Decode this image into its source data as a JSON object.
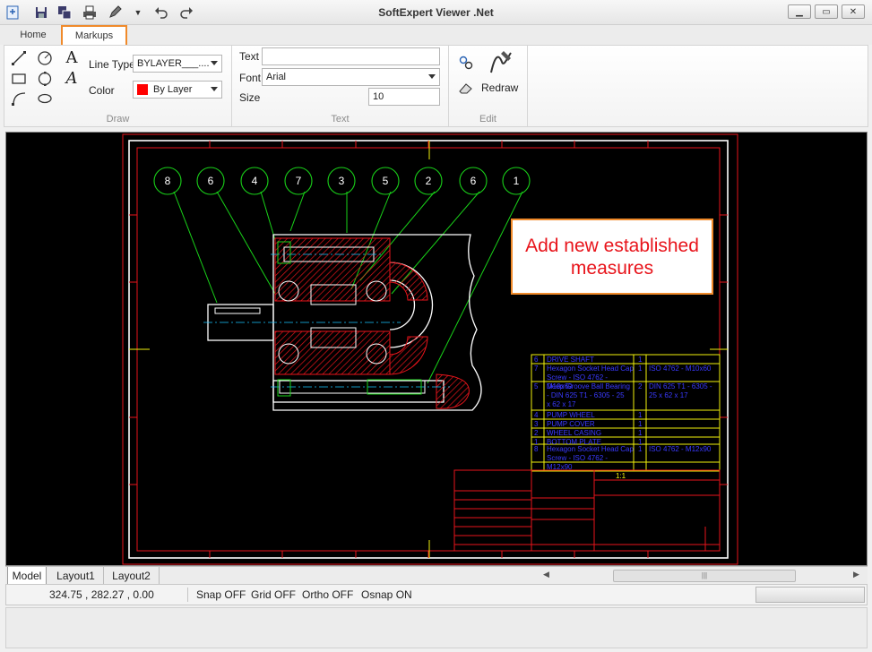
{
  "window": {
    "title": "SoftExpert Viewer .Net"
  },
  "quick_access": [
    "app-icon",
    "save-icon",
    "save-all-icon",
    "print-icon",
    "pen-icon",
    "dropdown-arrow-icon",
    "undo-icon",
    "redo-icon"
  ],
  "tabs": [
    {
      "label": "Home"
    },
    {
      "label": "Markups",
      "selected": true
    }
  ],
  "ribbon": {
    "draw": {
      "caption": "Draw",
      "line_type_label": "Line Type",
      "line_type_value": "BYLAYER___....",
      "color_label": "Color",
      "color_value": "By Layer",
      "color_swatch": "#ff0000"
    },
    "text": {
      "caption": "Text",
      "text_label": "Text",
      "text_value": "",
      "font_label": "Font",
      "font_value": "Arial",
      "size_label": "Size",
      "size_value": "10"
    },
    "edit": {
      "caption": "Edit",
      "redraw_label": "Redraw"
    }
  },
  "drawing": {
    "balloons": [
      "8",
      "6",
      "4",
      "7",
      "3",
      "5",
      "2",
      "6",
      "1"
    ],
    "annotation": "Add new established measures",
    "bom_rows": [
      {
        "no": "6",
        "desc": "DRIVE SHAFT",
        "qty": "1",
        "spec": ""
      },
      {
        "no": "7",
        "desc": "Hexagon Socket Head Cap Screw - ISO 4762 - M10x60",
        "qty": "1",
        "spec": "ISO 4762 - M10x60"
      },
      {
        "no": "5",
        "desc": "Deep Groove Ball Bearing - DIN 625 T1 - 6305 - 25 x 62 x 17",
        "qty": "2",
        "spec": "DIN 625 T1 - 6305 - 25 x 62 x 17"
      },
      {
        "no": "4",
        "desc": "PUMP WHEEL",
        "qty": "1",
        "spec": ""
      },
      {
        "no": "3",
        "desc": "PUMP COVER",
        "qty": "1",
        "spec": ""
      },
      {
        "no": "2",
        "desc": "WHEEL CASING",
        "qty": "1",
        "spec": ""
      },
      {
        "no": "1",
        "desc": "BOTTOM PLATE",
        "qty": "1",
        "spec": ""
      },
      {
        "no": "8",
        "desc": "Hexagon Socket Head Cap Screw - ISO 4762 - M12x90",
        "qty": "1",
        "spec": "ISO 4762 - M12x90"
      }
    ],
    "scale": "1:1"
  },
  "layout_tabs": [
    {
      "label": "Model",
      "selected": true
    },
    {
      "label": "Layout1"
    },
    {
      "label": "Layout2"
    }
  ],
  "status": {
    "coords": "324.75 , 282.27 , 0.00",
    "snap": "Snap OFF",
    "grid": "Grid OFF",
    "ortho": "Ortho OFF",
    "osnap": "Osnap ON"
  },
  "colors": {
    "accent": "#f08a2a",
    "cad_red": "#e8141b",
    "cad_green": "#19d219",
    "cad_yellow": "#f2f20c",
    "cad_blue": "#3a3aff"
  }
}
